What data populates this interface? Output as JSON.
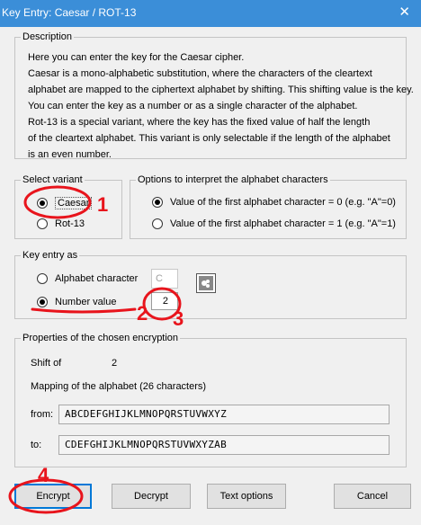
{
  "window": {
    "title": "Key Entry: Caesar / ROT-13",
    "close_glyph": "✕"
  },
  "description": {
    "legend": "Description",
    "lines": [
      "Here you can enter the key for the Caesar cipher.",
      "Caesar is a mono-alphabetic substitution, where the characters of the cleartext",
      "alphabet are mapped to the ciphertext alphabet by shifting. This shifting value is the key.",
      "You can enter the key as a number or as a single character of the alphabet.",
      "Rot-13 is a special variant, where the key has the fixed value of half the length",
      "of the cleartext alphabet. This variant is only selectable if the length of the alphabet",
      "is an even number."
    ]
  },
  "variant": {
    "legend": "Select variant",
    "caesar": "Caesar",
    "rot13": "Rot-13",
    "selected": "caesar"
  },
  "interpret": {
    "legend": "Options to interpret the alphabet characters",
    "option0": "Value of the first alphabet character = 0 (e.g. \"A\"=0)",
    "option1": "Value of the first alphabet character = 1 (e.g. \"A\"=1)",
    "selected": "option0"
  },
  "key_entry": {
    "legend": "Key entry as",
    "alphabet_char_label": "Alphabet character",
    "alphabet_char_value": "C",
    "number_label": "Number value",
    "number_value": "2",
    "selected": "number"
  },
  "properties": {
    "legend": "Properties of the chosen encryption",
    "shift_label": "Shift of",
    "shift_value": "2",
    "mapping_label": "Mapping of the alphabet (26 characters)",
    "from_label": "from:",
    "from_value": "ABCDEFGHIJKLMNOPQRSTUVWXYZ",
    "to_label": "to:",
    "to_value": "CDEFGHIJKLMNOPQRSTUVWXYZAB"
  },
  "buttons": {
    "encrypt": "Encrypt",
    "decrypt": "Decrypt",
    "text_options": "Text options",
    "cancel": "Cancel"
  },
  "annotations": {
    "color": "#e8141c",
    "marks": [
      "1",
      "2",
      "3",
      "4"
    ]
  }
}
